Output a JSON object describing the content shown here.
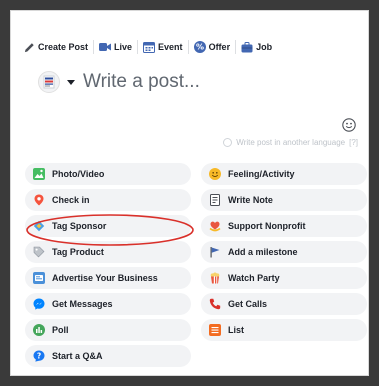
{
  "toolbar": {
    "create_post": "Create Post",
    "live": "Live",
    "event": "Event",
    "offer": "Offer",
    "job": "Job"
  },
  "composer": {
    "placeholder": "Write a post...",
    "another_language": "Write post in another language",
    "help": "[?]"
  },
  "options": [
    {
      "label": "Photo/Video",
      "icon": "photo-icon"
    },
    {
      "label": "Feeling/Activity",
      "icon": "smiley-icon"
    },
    {
      "label": "Check in",
      "icon": "location-pin-icon"
    },
    {
      "label": "Write Note",
      "icon": "note-icon"
    },
    {
      "label": "Tag Sponsor",
      "icon": "handshake-icon"
    },
    {
      "label": "Support Nonprofit",
      "icon": "heart-hands-icon"
    },
    {
      "label": "Tag Product",
      "icon": "tag-icon"
    },
    {
      "label": "Add a milestone",
      "icon": "flag-icon"
    },
    {
      "label": "Advertise Your Business",
      "icon": "advertise-icon"
    },
    {
      "label": "Watch Party",
      "icon": "popcorn-icon"
    },
    {
      "label": "Get Messages",
      "icon": "messenger-icon"
    },
    {
      "label": "Get Calls",
      "icon": "phone-icon"
    },
    {
      "label": "Poll",
      "icon": "poll-icon"
    },
    {
      "label": "List",
      "icon": "list-icon"
    },
    {
      "label": "Start a Q&A",
      "icon": "question-icon"
    }
  ],
  "colors": {
    "accent_blue": "#4267b2",
    "highlight_red": "#d9302a",
    "pill_bg": "#f2f3f5"
  }
}
